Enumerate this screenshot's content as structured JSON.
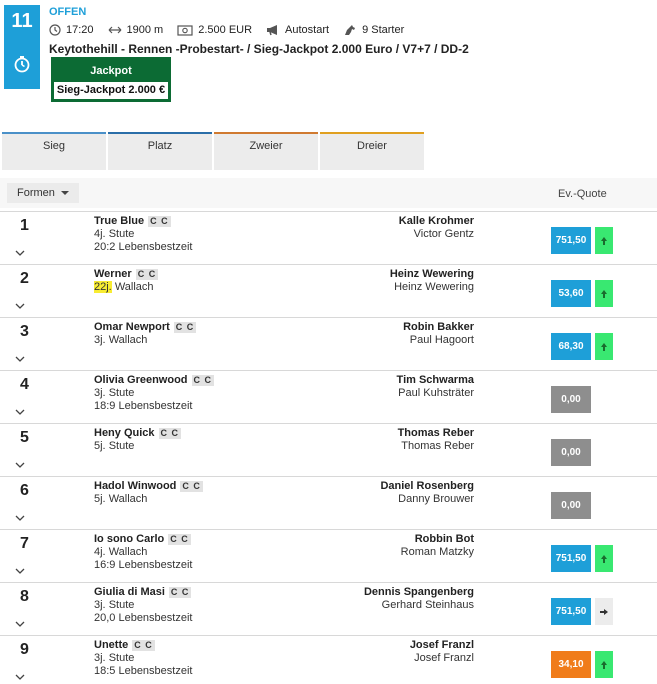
{
  "race": {
    "number": "11",
    "status": "OFFEN",
    "time": "17:20",
    "distance": "1900 m",
    "prize": "2.500 EUR",
    "start_type": "Autostart",
    "starters": "9 Starter",
    "title": "Keytothehill - Rennen -Probestart- / Sieg-Jackpot 2.000 Euro / V7+7 / DD-2",
    "jackpot_label": "Jackpot",
    "jackpot_value": "Sieg-Jackpot 2.000 €"
  },
  "tabs": [
    "Sieg",
    "Platz",
    "Zweier",
    "Dreier"
  ],
  "columns": {
    "formen": "Formen",
    "quote": "Ev.-Quote"
  },
  "runners": [
    {
      "num": "1",
      "name": "True Blue",
      "badge": "C C",
      "age": "4j.",
      "sex": "Stute",
      "record": "20:2 Lebensbestzeit",
      "driver": "Kalle Krohmer",
      "trainer": "Victor Gentz",
      "quote": "751,50",
      "quote_color": "blue",
      "trend": "up"
    },
    {
      "num": "2",
      "name": "Werner",
      "badge": "C C",
      "age": "22j.",
      "sex": "Wallach",
      "record": "",
      "driver": "Heinz Wewering",
      "trainer": "Heinz Wewering",
      "quote": "53,60",
      "quote_color": "blue",
      "trend": "up"
    },
    {
      "num": "3",
      "name": "Omar Newport",
      "badge": "C C",
      "age": "3j.",
      "sex": "Wallach",
      "record": "",
      "driver": "Robin Bakker",
      "trainer": "Paul Hagoort",
      "quote": "68,30",
      "quote_color": "blue",
      "trend": "up"
    },
    {
      "num": "4",
      "name": "Olivia Greenwood",
      "badge": "C C",
      "age": "3j.",
      "sex": "Stute",
      "record": "18:9 Lebensbestzeit",
      "driver": "Tim Schwarma",
      "trainer": "Paul Kuhsträter",
      "quote": "0,00",
      "quote_color": "gray",
      "trend": "none"
    },
    {
      "num": "5",
      "name": "Heny Quick",
      "badge": "C C",
      "age": "5j.",
      "sex": "Stute",
      "record": "",
      "driver": "Thomas Reber",
      "trainer": "Thomas Reber",
      "quote": "0,00",
      "quote_color": "gray",
      "trend": "none"
    },
    {
      "num": "6",
      "name": "Hadol Winwood",
      "badge": "C C",
      "age": "5j.",
      "sex": "Wallach",
      "record": "",
      "driver": "Daniel Rosenberg",
      "trainer": "Danny Brouwer",
      "quote": "0,00",
      "quote_color": "gray",
      "trend": "none"
    },
    {
      "num": "7",
      "name": "Io sono Carlo",
      "badge": "C C",
      "age": "4j.",
      "sex": "Wallach",
      "record": "16:9 Lebensbestzeit",
      "driver": "Robbin Bot",
      "trainer": "Roman Matzky",
      "quote": "751,50",
      "quote_color": "blue",
      "trend": "up"
    },
    {
      "num": "8",
      "name": "Giulia di Masi",
      "badge": "C C",
      "age": "3j.",
      "sex": "Stute",
      "record": "20,0 Lebensbestzeit",
      "driver": "Dennis Spangenberg",
      "trainer": "Gerhard Steinhaus",
      "quote": "751,50",
      "quote_color": "blue",
      "trend": "right"
    },
    {
      "num": "9",
      "name": "Unette",
      "badge": "C C",
      "age": "3j.",
      "sex": "Stute",
      "record": "18:5 Lebensbestzeit",
      "driver": "Josef Franzl",
      "trainer": "Josef Franzl",
      "quote": "34,10",
      "quote_color": "orange",
      "trend": "up"
    }
  ]
}
